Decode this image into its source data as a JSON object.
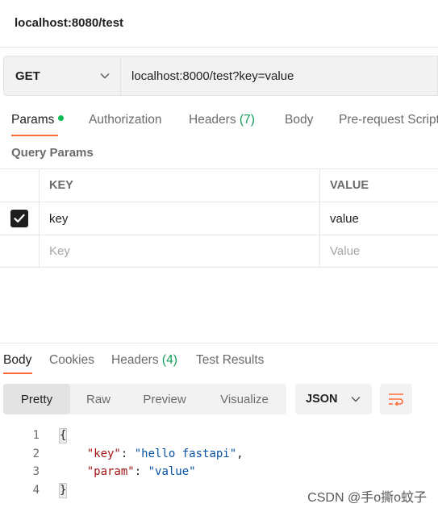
{
  "request": {
    "title": "localhost:8080/test",
    "method": "GET",
    "url": "localhost:8000/test?key=value"
  },
  "request_tabs": [
    {
      "label": "Params",
      "count": ""
    },
    {
      "label": "Authorization",
      "count": ""
    },
    {
      "label": "Headers ",
      "count": "(7)"
    },
    {
      "label": "Body",
      "count": ""
    },
    {
      "label": "Pre-request Script",
      "count": ""
    }
  ],
  "query_params": {
    "title": "Query Params",
    "columns": [
      "KEY",
      "VALUE"
    ],
    "rows": [
      {
        "key": "key",
        "value": "value",
        "checked": true
      }
    ],
    "placeholder": {
      "key": "Key",
      "value": "Value"
    }
  },
  "response_tabs": [
    {
      "label": "Body",
      "count": ""
    },
    {
      "label": "Cookies",
      "count": ""
    },
    {
      "label": "Headers ",
      "count": "(4)"
    },
    {
      "label": "Test Results",
      "count": ""
    }
  ],
  "view_modes": [
    "Pretty",
    "Raw",
    "Preview",
    "Visualize"
  ],
  "format": "JSON",
  "body": {
    "line_numbers": [
      "1",
      "2",
      "3",
      "4"
    ],
    "open_brace": "{",
    "close_brace": "}",
    "k1": "\"key\"",
    "v1": "\"hello fastapi\"",
    "k2": "\"param\"",
    "v2": "\"value\"",
    "colon": ": ",
    "comma": ","
  },
  "watermark": "CSDN @手o撕o蚊子",
  "colors": {
    "accent": "#ff6c37",
    "dot": "#0cbb52",
    "count": "#0f9d58"
  },
  "icons": [
    "chevron-down-icon",
    "checkmark-icon",
    "wrap-lines-icon"
  ]
}
